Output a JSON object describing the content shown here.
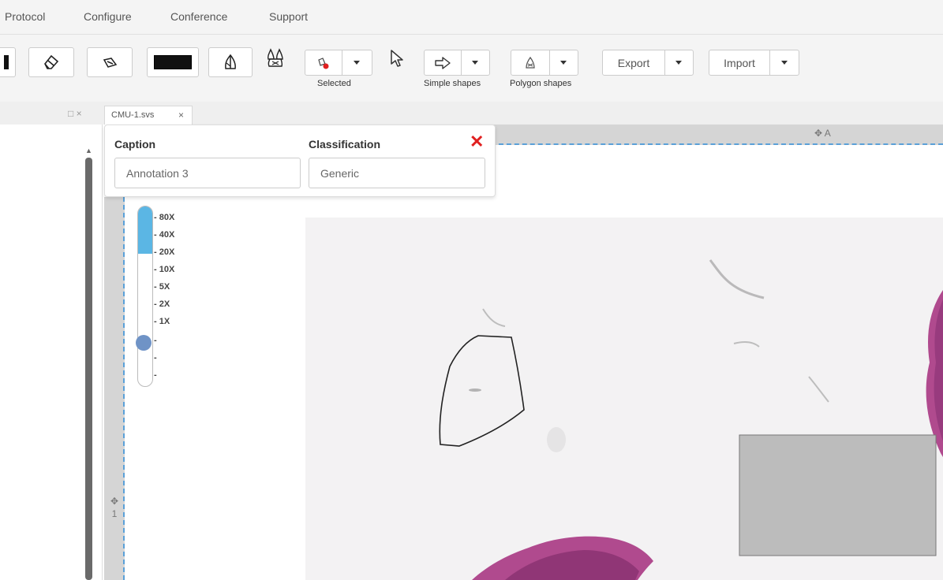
{
  "menu": {
    "items": [
      "Protocol",
      "Configure",
      "Conference",
      "Support"
    ]
  },
  "toolbar": {
    "selected_label": "Selected",
    "simple_shapes_label": "Simple shapes",
    "polygon_shapes_label": "Polygon shapes",
    "export_label": "Export",
    "import_label": "Import"
  },
  "tab": {
    "label": "CMU-1.svs",
    "close": "×"
  },
  "panel_controls": "□ ×",
  "popup": {
    "caption_label": "Caption",
    "caption_value": "Annotation 3",
    "classification_label": "Classification",
    "classification_value": "Generic",
    "close": "✕"
  },
  "viewer": {
    "move_top_label": "✥ A",
    "move_left_icon": "✥",
    "move_left_label": "1"
  },
  "zoom": {
    "levels": [
      "- 80X",
      "- 40X",
      "- 20X",
      "- 10X",
      "- 5X",
      "- 2X",
      "- 1X",
      "-",
      "-",
      "-"
    ]
  },
  "colors": {
    "close_red": "#e02020",
    "zoom_fill": "#5bb6e4",
    "zoom_thumb": "#6f93c6",
    "dashed_border": "#5aa0d8",
    "tissue": "#b04a8e",
    "rectangle_annotation": "#bcbcbc"
  }
}
